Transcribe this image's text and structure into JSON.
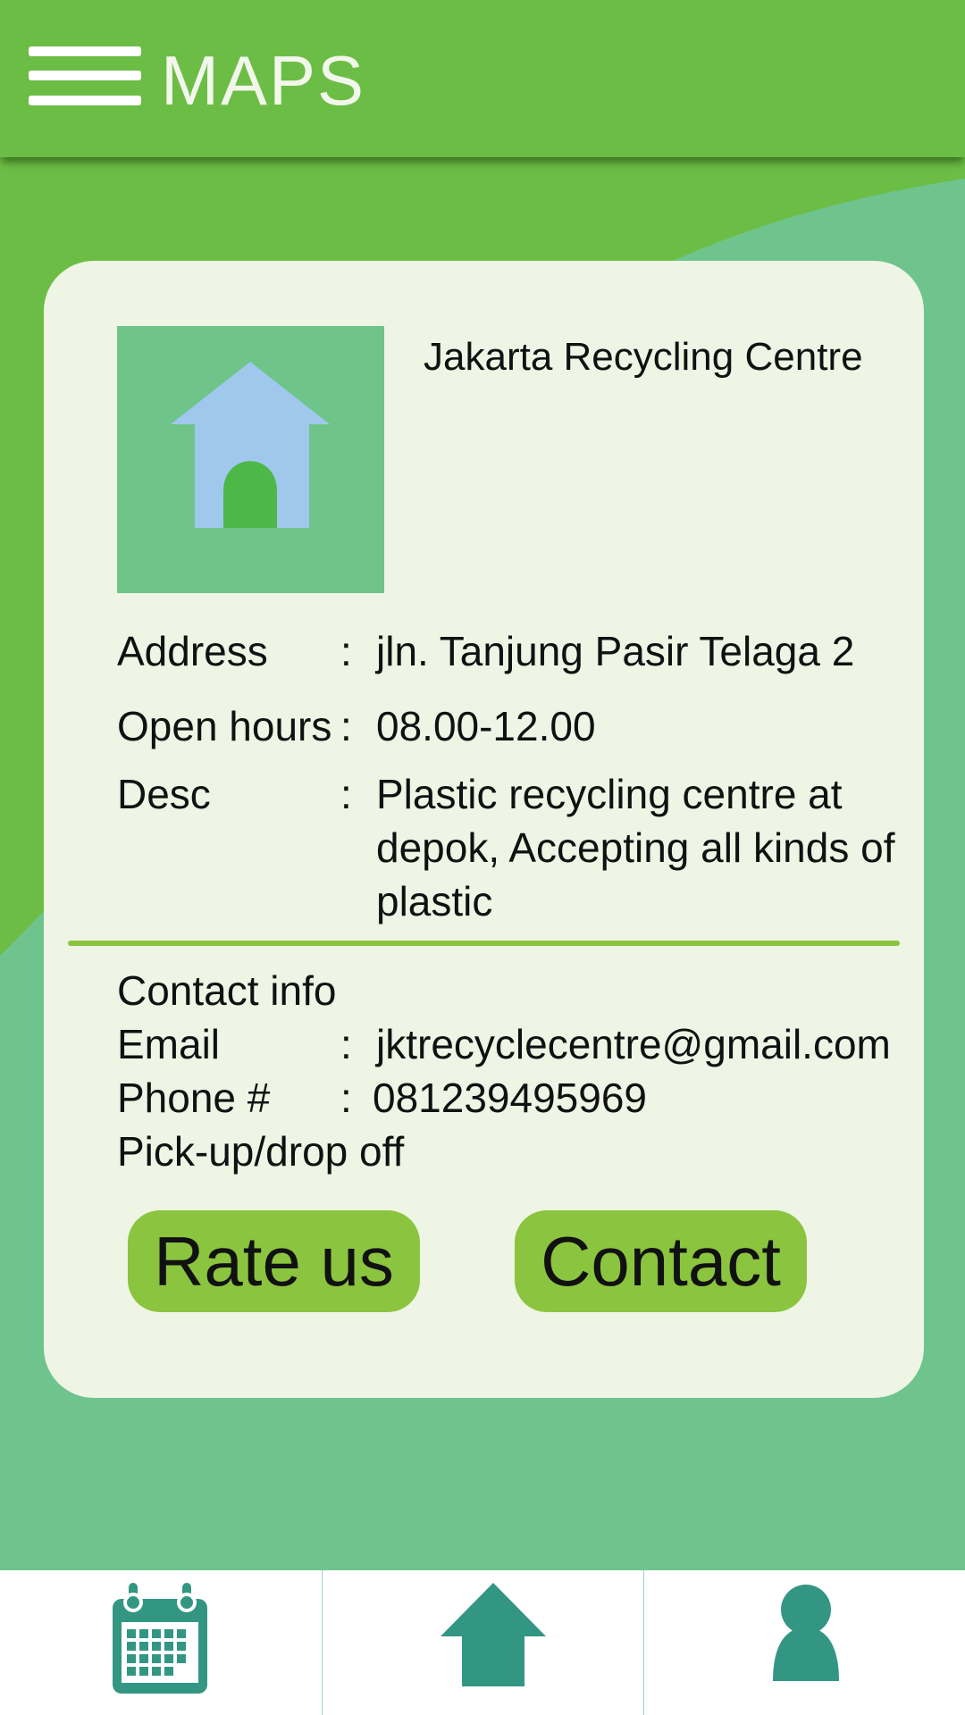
{
  "header": {
    "title": "MAPS"
  },
  "place": {
    "name": "Jakarta Recycling Centre",
    "image_icon": "house-icon"
  },
  "details": {
    "address_label": "Address",
    "address_value": "jln. Tanjung Pasir Telaga 2",
    "hours_label": "Open hours",
    "hours_value": "08.00-12.00",
    "desc_label": "Desc",
    "desc_value": "Plastic recycling centre at depok, Accepting all kinds of plastic",
    "separator": ":"
  },
  "contact": {
    "heading": "Contact info",
    "email_label": "Email",
    "email_value": "jktrecyclecentre@gmail.com",
    "phone_label": "Phone #",
    "phone_value": "081239495969",
    "pickup_text": "Pick-up/drop off"
  },
  "buttons": {
    "rate_label": "Rate us",
    "contact_label": "Contact"
  },
  "bottom_nav": [
    {
      "icon": "calendar-icon"
    },
    {
      "icon": "home-icon"
    },
    {
      "icon": "profile-icon"
    }
  ],
  "colors": {
    "header_green": "#6cbd45",
    "light_green": "#6ec489",
    "card_bg": "#eef5e4",
    "button_green": "#8bc43f",
    "nav_teal": "#339683",
    "house_blue": "#a0c8ec"
  }
}
